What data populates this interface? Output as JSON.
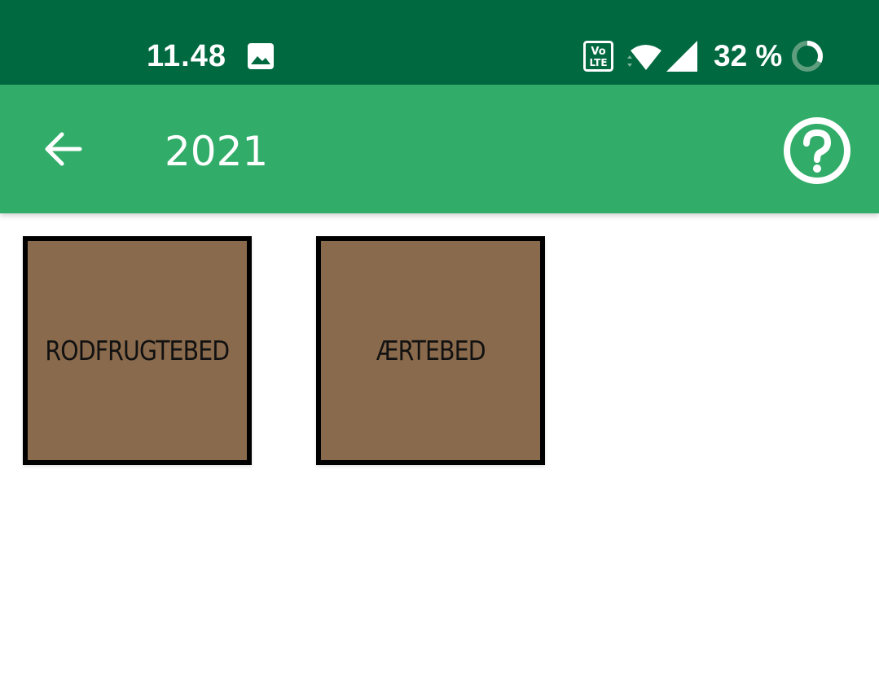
{
  "status_bar": {
    "time": "11.48",
    "battery_percent": "32 %",
    "battery_level": 0.32,
    "icons": [
      "image-icon",
      "volte-icon",
      "wifi-icon",
      "signal-icon",
      "battery-saver-icon"
    ]
  },
  "app_bar": {
    "title": "2021",
    "back_icon": "arrow-left-icon",
    "help_icon": "help-circle-icon"
  },
  "beds": [
    {
      "label": "RODFRUGTEBED"
    },
    {
      "label": "ÆRTEBED"
    }
  ],
  "colors": {
    "status_bar": "#006940",
    "app_bar": "#31ad69",
    "bed_fill": "#8a6a4c",
    "bed_border": "#000000"
  }
}
